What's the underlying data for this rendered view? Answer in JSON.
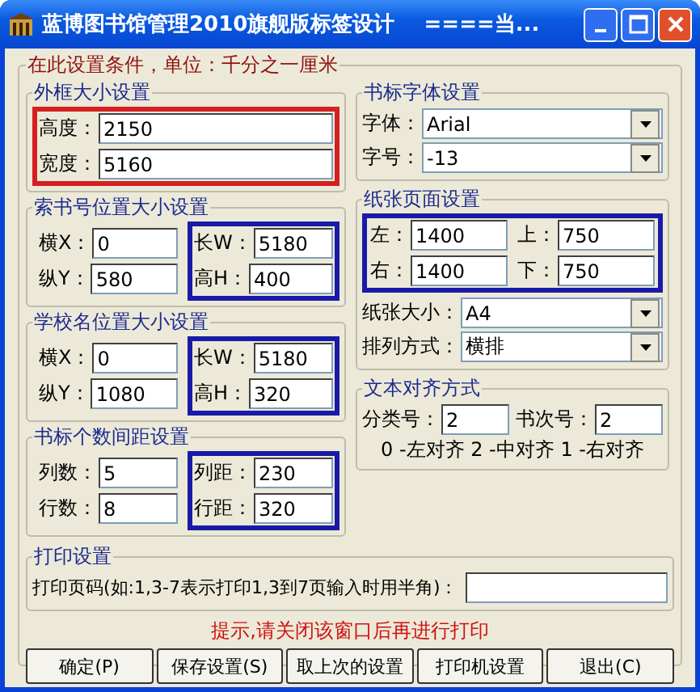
{
  "window": {
    "title": "蓝博图书馆管理2010旗舰版标签设计    ====当..."
  },
  "settings": {
    "legend": "在此设置条件，单位：千分之一厘米",
    "left_groups": [
      {
        "legend": "外框大小设置",
        "columns": [
          {
            "color": "#d42020",
            "fields": [
              {
                "label": "高度：",
                "value": "2150"
              },
              {
                "label": "宽度：",
                "value": "5160"
              }
            ]
          }
        ]
      },
      {
        "legend": "索书号位置大小设置",
        "columns": [
          {
            "fields": [
              {
                "label": "横X：",
                "value": "0"
              },
              {
                "label": "纵Y：",
                "value": "580"
              }
            ]
          },
          {
            "color": "#1a1aa8",
            "fields": [
              {
                "label": "长W：",
                "value": "5180"
              },
              {
                "label": "高H：",
                "value": "400"
              }
            ]
          }
        ]
      },
      {
        "legend": "学校名位置大小设置",
        "columns": [
          {
            "fields": [
              {
                "label": "横X：",
                "value": "0"
              },
              {
                "label": "纵Y：",
                "value": "1080"
              }
            ]
          },
          {
            "color": "#1a1aa8",
            "fields": [
              {
                "label": "长W：",
                "value": "5180"
              },
              {
                "label": "高H：",
                "value": "320"
              }
            ]
          }
        ]
      },
      {
        "legend": "书标个数间距设置",
        "columns": [
          {
            "fields": [
              {
                "label": "列数：",
                "value": "5"
              },
              {
                "label": "行数：",
                "value": "8"
              }
            ]
          },
          {
            "color": "#1a1aa8",
            "fields": [
              {
                "label": "列距：",
                "value": "230"
              },
              {
                "label": "行距：",
                "value": "320"
              }
            ]
          }
        ]
      }
    ],
    "font_group": {
      "legend": "书标字体设置",
      "selects": [
        {
          "label": "字体：",
          "value": "Arial"
        },
        {
          "label": "字号：",
          "value": "-13"
        }
      ]
    },
    "paper_group": {
      "legend": "纸张页面设置",
      "margins": {
        "color": "#1a1aa8",
        "columns": [
          [
            {
              "label": "左：",
              "value": "1400"
            },
            {
              "label": "右：",
              "value": "1400"
            }
          ],
          [
            {
              "label": "上：",
              "value": "750"
            },
            {
              "label": "下：",
              "value": "750"
            }
          ]
        ]
      },
      "selects": [
        {
          "label": "纸张大小：",
          "value": "A4"
        },
        {
          "label": "排列方式：",
          "value": "横排"
        }
      ]
    },
    "align_group": {
      "legend": "文本对齐方式",
      "fields": [
        {
          "label": "分类号：",
          "value": "2"
        },
        {
          "label": "书次号：",
          "value": "2"
        }
      ],
      "note": "0 -左对齐 2 -中对齐 1 -右对齐"
    },
    "print_group": {
      "legend": "打印设置",
      "label": "打印页码(如:1,3-7表示打印1,3到7页输入时用半角)："
    },
    "hint": "提示,请关闭该窗口后再进行打印",
    "buttons": [
      "确定(P)",
      "保存设置(S)",
      "取上次的设置",
      "打印机设置",
      "退出(C)"
    ]
  }
}
